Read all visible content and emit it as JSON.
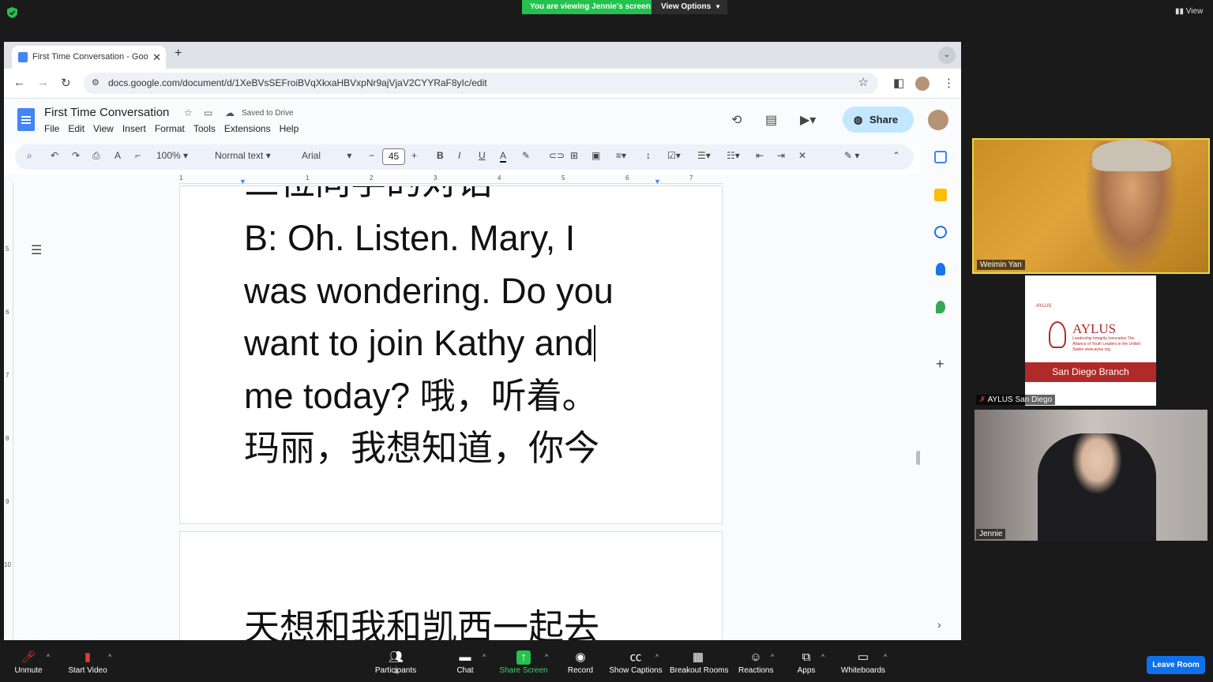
{
  "zoom": {
    "viewing_banner": "You are viewing Jennie's screen",
    "view_options": "View Options",
    "view_top": "View",
    "participants_count": "3",
    "toolbar": [
      {
        "label": "Unmute",
        "icon": "mic-muted-icon"
      },
      {
        "label": "Start Video",
        "icon": "video-off-icon"
      },
      {
        "label": "Participants",
        "icon": "participants-icon"
      },
      {
        "label": "Chat",
        "icon": "chat-icon"
      },
      {
        "label": "Share Screen",
        "icon": "share-screen-icon"
      },
      {
        "label": "Record",
        "icon": "record-icon"
      },
      {
        "label": "Show Captions",
        "icon": "captions-icon"
      },
      {
        "label": "Breakout Rooms",
        "icon": "breakout-rooms-icon"
      },
      {
        "label": "Reactions",
        "icon": "reactions-icon"
      },
      {
        "label": "Apps",
        "icon": "apps-icon"
      },
      {
        "label": "Whiteboards",
        "icon": "whiteboards-icon"
      }
    ],
    "leave_label": "Leave Room",
    "tiles": [
      {
        "name": "Weimin Yan"
      },
      {
        "name": "AYLUS San Diego",
        "brand": "AYLUS",
        "brand_small": "AYLUS",
        "tagline": "Leadership Integrity Innovation The Alliance of Youth Leaders in the United States www.aylus.org",
        "band": "San Diego Branch"
      },
      {
        "name": "Jennie"
      }
    ],
    "colors": {
      "accent_green": "#24c14f",
      "leave_blue": "#0e71eb",
      "active_speaker": "#e7d84a"
    }
  },
  "browser": {
    "tab_title": "First Time Conversation - Goo",
    "url": "docs.google.com/document/d/1XeBVsSEFroiBVqXkxaHBVxpNr9ajVjaV2CYYRaF8yIc/edit"
  },
  "docs": {
    "title": "First Time Conversation",
    "saved_status": "Saved to Drive",
    "menu": [
      "File",
      "Edit",
      "View",
      "Insert",
      "Format",
      "Tools",
      "Extensions",
      "Help"
    ],
    "share_label": "Share",
    "toolbar": {
      "zoom": "100%",
      "style": "Normal text",
      "font": "Arial",
      "font_size": "45"
    },
    "ruler_numbers": [
      "1",
      "1",
      "2",
      "3",
      "4",
      "5",
      "6",
      "7"
    ],
    "vruler_numbers": [
      "5",
      "6",
      "7",
      "8",
      "9",
      "10"
    ],
    "page1_lines": [
      "B: Oh. Listen. Mary, I",
      "was wondering. Do you",
      "want to join Kathy and",
      "me today? 哦，听着。",
      "玛丽，我想知道，你今"
    ],
    "page1_cut_line": "三位同学的对话",
    "page2_line": "天想和我和凯西一起去"
  }
}
